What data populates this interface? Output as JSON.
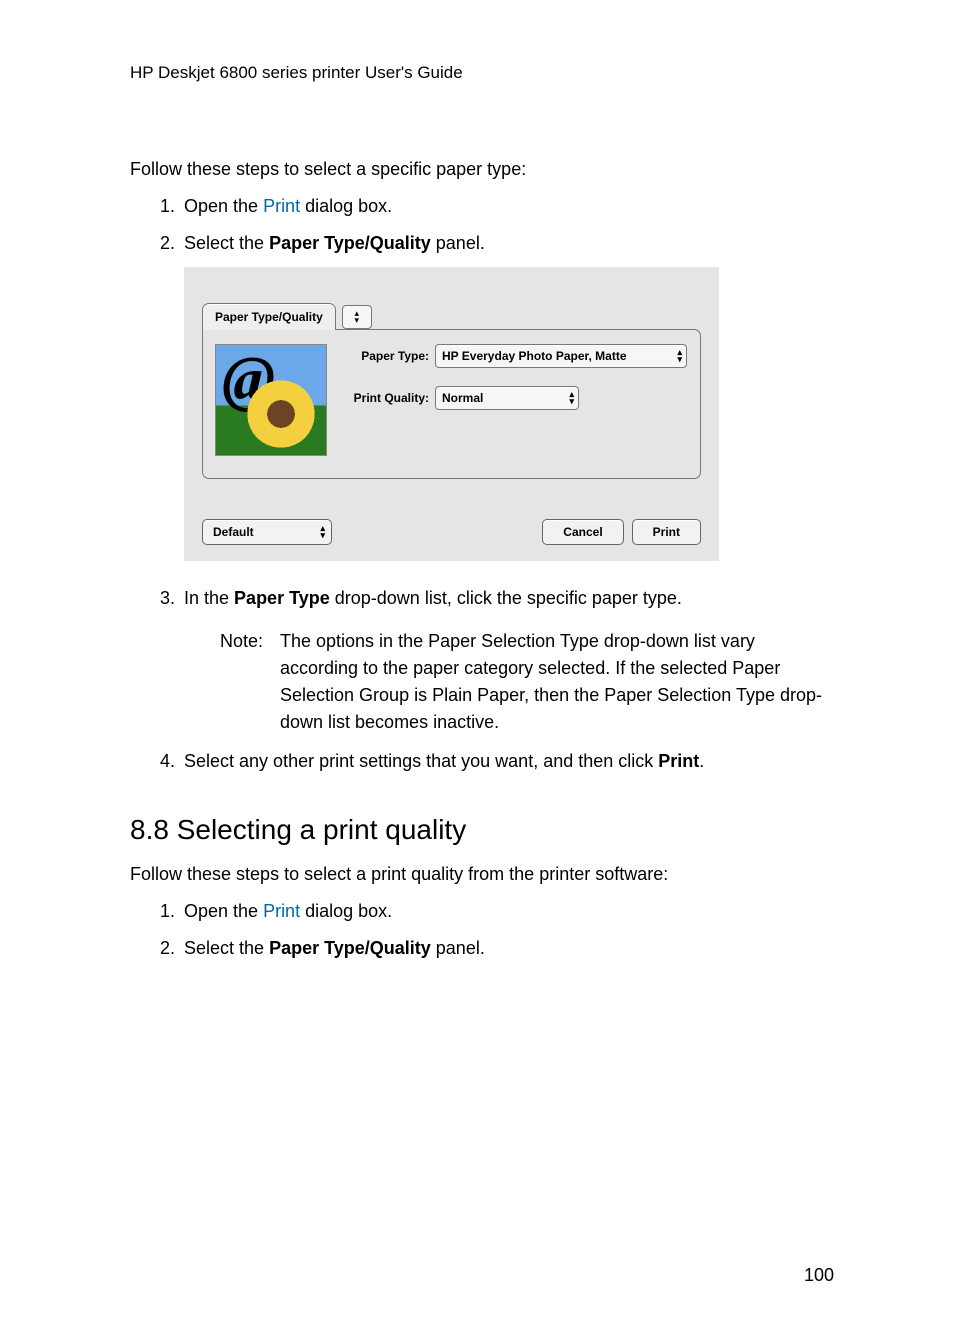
{
  "header": "HP Deskjet 6800 series printer User's Guide",
  "section1": {
    "intro": "Follow these steps to select a specific paper type:",
    "step1_pre": "Open the ",
    "step1_link": "Print",
    "step1_post": " dialog box.",
    "step2_pre": "Select the ",
    "step2_strong": "Paper Type/Quality",
    "step2_post": " panel.",
    "step3_pre": "In the ",
    "step3_strong": "Paper Type",
    "step3_post": " drop-down list, click the specific paper type.",
    "note_label": "Note:",
    "note_text": "The options in the Paper Selection Type drop-down list vary according to the paper category selected. If the selected Paper Selection Group is Plain Paper, then the Paper Selection Type drop-down list becomes inactive.",
    "step4_pre": "Select any other print settings that you want, and then click ",
    "step4_strong": "Print",
    "step4_post": "."
  },
  "dialog": {
    "panel_tab": "Paper Type/Quality",
    "paper_type_label": "Paper Type:",
    "paper_type_value": "HP Everyday Photo Paper, Matte",
    "print_quality_label": "Print Quality:",
    "print_quality_value": "Normal",
    "default_btn": "Default",
    "cancel_btn": "Cancel",
    "print_btn": "Print"
  },
  "section2": {
    "heading": "8.8  Selecting a print quality",
    "intro": "Follow these steps to select a print quality from the printer software:",
    "step1_pre": "Open the ",
    "step1_link": "Print",
    "step1_post": " dialog box.",
    "step2_pre": "Select the ",
    "step2_strong": "Paper Type/Quality",
    "step2_post": " panel."
  },
  "page_number": "100"
}
